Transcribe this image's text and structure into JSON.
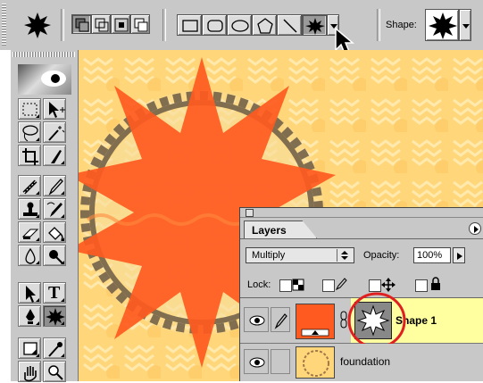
{
  "options_bar": {
    "shape_label": "Shape:"
  },
  "layers_panel": {
    "tab_label": "Layers",
    "blend_mode": "Multiply",
    "opacity_label": "Opacity:",
    "opacity_value": "100%",
    "lock_label": "Lock:",
    "layers": [
      {
        "name": "Shape 1",
        "selected": true
      },
      {
        "name": "foundation",
        "selected": false
      }
    ]
  },
  "toolbox": {
    "type_tool_glyph": "T"
  },
  "colors": {
    "canvas_bg": "#ffd77a",
    "star_fill": "#ff5a1f",
    "selection_highlight": "#ffffa0",
    "annotation_circle": "#e02020"
  }
}
